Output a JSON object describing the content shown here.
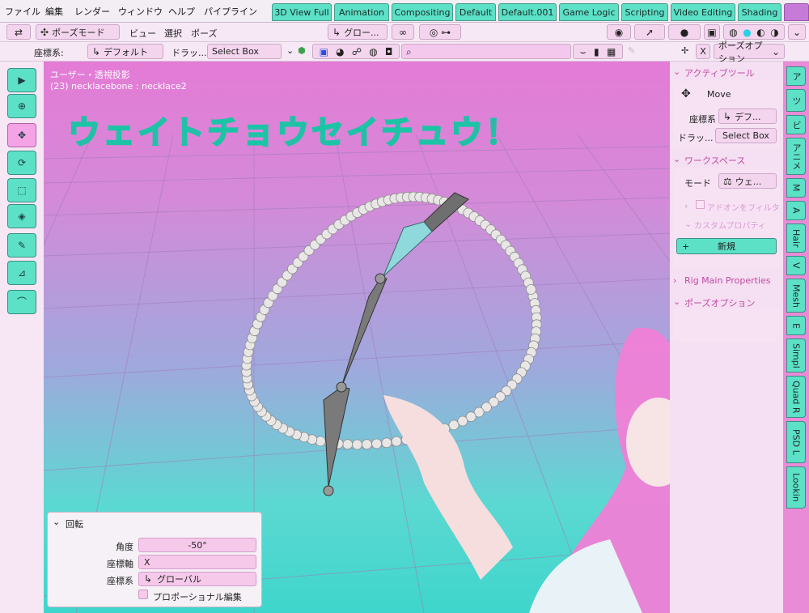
{
  "menubar": {
    "items": [
      "ファイル",
      "編集",
      "レンダー",
      "ウィンドウ",
      "ヘルプ",
      "パイプライン"
    ],
    "workspaces": [
      "3D View Full",
      "Animation",
      "Compositing",
      "Default",
      "Default.001",
      "Game Logic",
      "Scripting",
      "Video Editing",
      "Shading"
    ]
  },
  "header": {
    "mode": "ポーズモード",
    "menus": [
      "ビュー",
      "選択",
      "ポーズ"
    ],
    "transform_orientation": "グロー...",
    "coord_label": "座標系:",
    "coord_value": "デフォルト",
    "drag_label": "ドラッ...",
    "drag_value": "Select Box",
    "pose_options": "ポーズオプション",
    "close_x": "X"
  },
  "viewport": {
    "view_name": "ユーザー・透視投影",
    "object_info": "(23) necklacebone : necklace2",
    "overlay_text": "ウェイトチョウセイチュウ！"
  },
  "npanel": {
    "active_tool_title": "アクティブツール",
    "tool_name": "Move",
    "coord_label": "座標系",
    "coord_value": "デフ...",
    "drag_label": "ドラッ...",
    "drag_value": "Select Box",
    "workspace_title": "ワークスペース",
    "mode_label": "モード",
    "mode_value": "ウェ...",
    "addon_filter": "アドオンをフィルタ",
    "custom_props": "カスタムプロパティ",
    "new_button": "新規",
    "rig_props": "Rig Main Properties",
    "pose_options": "ポーズオプション"
  },
  "vtabs": [
    "ア",
    "ツ",
    "ビ",
    "アニメ",
    "M",
    "A",
    "Hair",
    "V",
    "Mesh",
    "E",
    "Simpl",
    "Quad R",
    "PSD L",
    "Lookin"
  ],
  "operator": {
    "title": "回転",
    "angle_label": "角度",
    "angle_value": "-50°",
    "axis_label": "座標軸",
    "axis_value": "X",
    "orient_label": "座標系",
    "orient_value": "グローバル",
    "proportional": "プロポーショナル編集"
  }
}
